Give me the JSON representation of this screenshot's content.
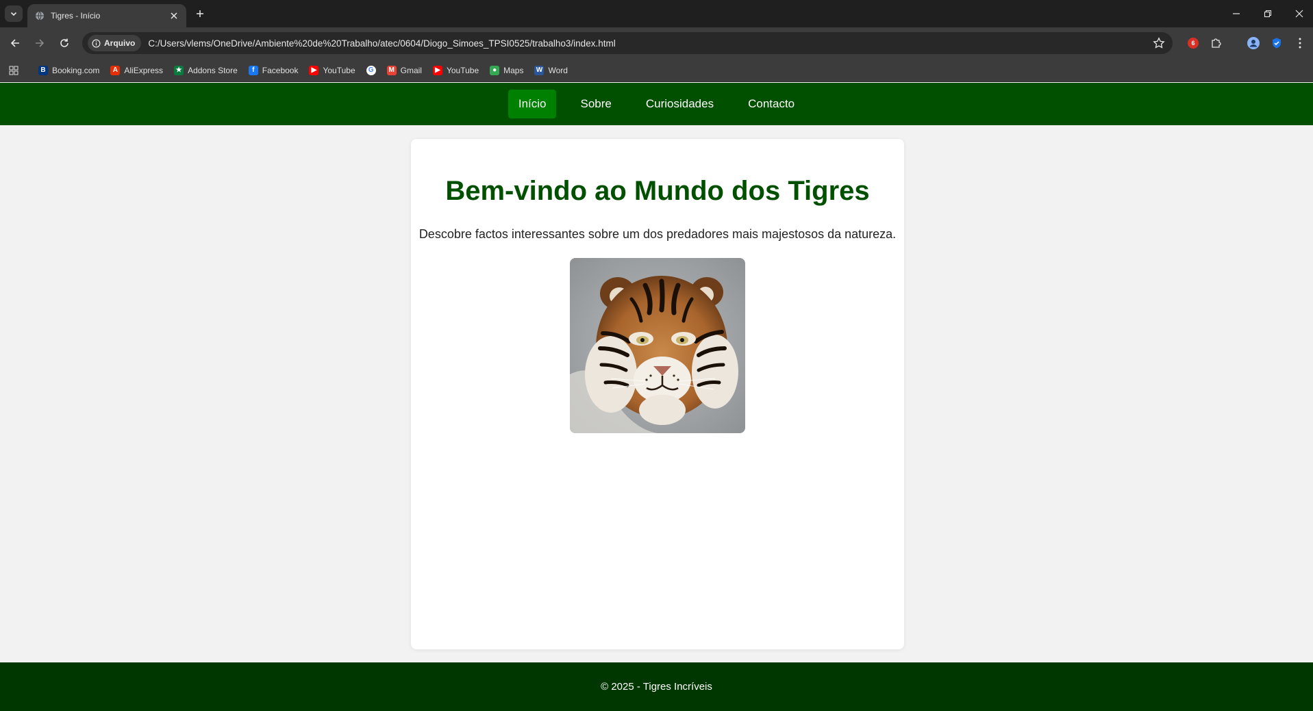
{
  "browser": {
    "tab": {
      "title": "Tigres - Início",
      "favicon": "globe-icon"
    },
    "address": {
      "chip_label": "Arquivo",
      "url": "C:/Users/vlems/OneDrive/Ambiente%20de%20Trabalho/atec/0604/Diogo_Simoes_TPSI0525/trabalho3/index.html"
    },
    "extension_badge": "6",
    "bookmarks": [
      {
        "label": "Booking.com",
        "icon": "booking-icon",
        "color": "#003580"
      },
      {
        "label": "AliExpress",
        "icon": "aliexpress-icon",
        "color": "#e62e04"
      },
      {
        "label": "Addons Store",
        "icon": "addons-store-icon",
        "color": "#0a7a3e"
      },
      {
        "label": "Facebook",
        "icon": "facebook-icon",
        "color": "#1877f2"
      },
      {
        "label": "YouTube",
        "icon": "youtube-icon",
        "color": "#ff0000"
      },
      {
        "label": "",
        "icon": "google-icon",
        "color": "#ffffff"
      },
      {
        "label": "Gmail",
        "icon": "gmail-icon",
        "color": "#ea4335"
      },
      {
        "label": "YouTube",
        "icon": "youtube-icon",
        "color": "#ff0000"
      },
      {
        "label": "Maps",
        "icon": "maps-icon",
        "color": "#34a853"
      },
      {
        "label": "Word",
        "icon": "word-icon",
        "color": "#2b579a"
      }
    ]
  },
  "site": {
    "nav": [
      {
        "label": "Início",
        "active": true
      },
      {
        "label": "Sobre",
        "active": false
      },
      {
        "label": "Curiosidades",
        "active": false
      },
      {
        "label": "Contacto",
        "active": false
      }
    ],
    "heading": "Bem-vindo ao Mundo dos Tigres",
    "intro": "Descobre factos interessantes sobre um dos predadores mais majestosos da natureza.",
    "footer": "© 2025 - Tigres Incríveis",
    "colors": {
      "nav_bg": "#005000",
      "nav_active": "#008000",
      "heading": "#005000",
      "footer_bg": "#003700"
    }
  }
}
